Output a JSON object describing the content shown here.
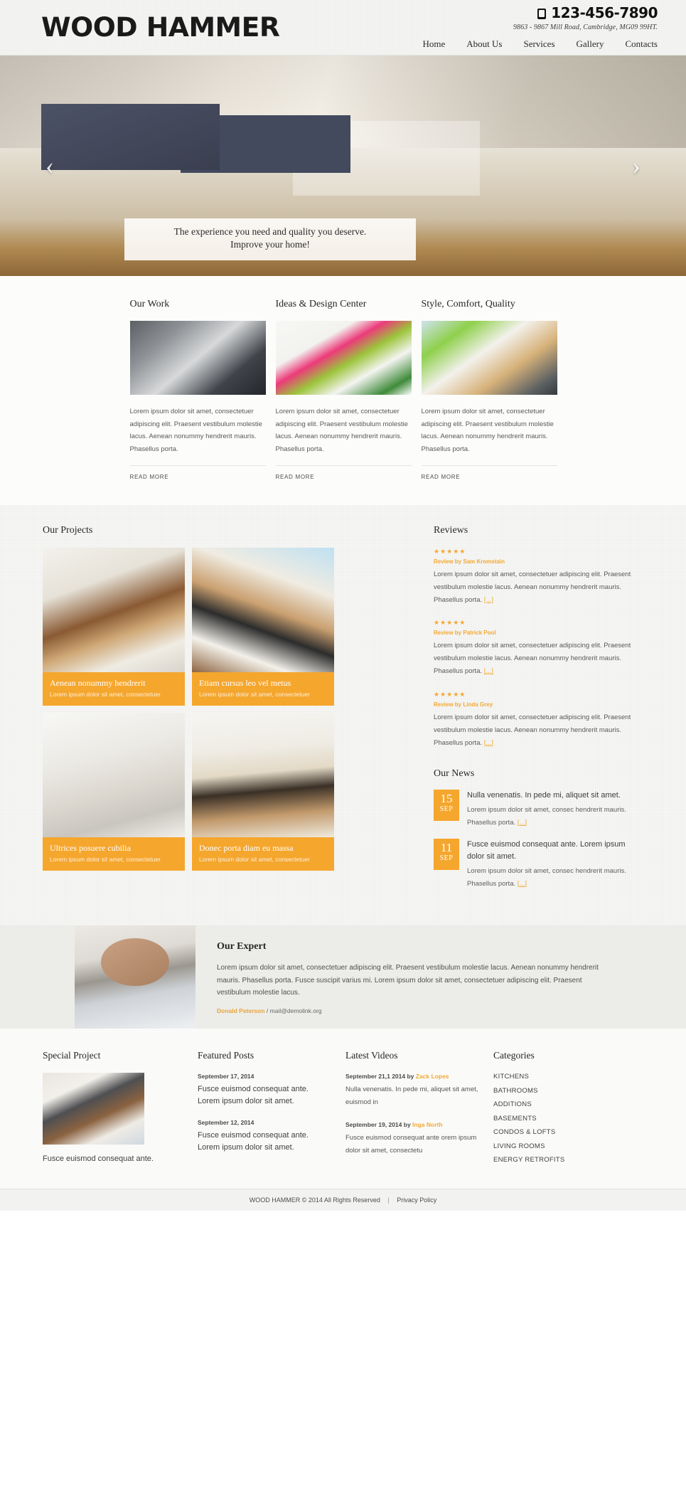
{
  "header": {
    "logo": "WOOD HAMMER",
    "phone": "123-456-7890",
    "address": "9863 - 9867 Mill Road, Cambridge, MG09 99HT.",
    "nav": [
      {
        "label": "Home"
      },
      {
        "label": "About Us"
      },
      {
        "label": "Services"
      },
      {
        "label": "Gallery"
      },
      {
        "label": "Contacts"
      }
    ]
  },
  "slider": {
    "prev": "‹",
    "next": "›",
    "caption_line1": "The experience you need and quality you deserve.",
    "caption_line2": "Improve your home!"
  },
  "features": {
    "items": [
      {
        "title": "Our Work",
        "text": "Lorem ipsum dolor sit amet, consectetuer adipiscing elit. Praesent vestibulum molestie lacus. Aenean nonummy hendrerit mauris. Phasellus porta.",
        "link": "READ MORE"
      },
      {
        "title": "Ideas & Design Center",
        "text": "Lorem ipsum dolor sit amet, consectetuer adipiscing elit. Praesent vestibulum molestie lacus. Aenean nonummy hendrerit mauris. Phasellus porta.",
        "link": "READ MORE"
      },
      {
        "title": "Style, Comfort, Quality",
        "text": "Lorem ipsum dolor sit amet, consectetuer adipiscing elit. Praesent vestibulum molestie lacus. Aenean nonummy hendrerit mauris. Phasellus porta.",
        "link": "READ MORE"
      }
    ]
  },
  "projects": {
    "title": "Our Projects",
    "items": [
      {
        "title": "Aenean nonummy hendrerit",
        "subtitle": "Lorem ipsum dolor sit amet, consectetuer"
      },
      {
        "title": "Etiam cursus leo vel metus",
        "subtitle": "Lorem ipsum dolor sit amet, consectetuer"
      },
      {
        "title": "Ultrices posuere cubilia",
        "subtitle": "Lorem ipsum dolor sit amet, consectetuer"
      },
      {
        "title": "Donec porta diam eu massa",
        "subtitle": "Lorem ipsum dolor sit amet, consectetuer"
      }
    ]
  },
  "reviews": {
    "title": "Reviews",
    "stars": "★★★★★",
    "by_label": "Review by ",
    "more": "[...]",
    "items": [
      {
        "author": "Sam Kromstain",
        "text": "Lorem ipsum dolor sit amet, consectetuer adipiscing elit. Praesent vestibulum molestie lacus. Aenean nonummy hendrerit mauris. Phasellus porta. "
      },
      {
        "author": "Patrick Pool",
        "text": "Lorem ipsum dolor sit amet, consectetuer adipiscing elit. Praesent vestibulum molestie lacus. Aenean nonummy hendrerit mauris. Phasellus porta. "
      },
      {
        "author": "Linda Grey",
        "text": "Lorem ipsum dolor sit amet, consectetuer adipiscing elit. Praesent vestibulum molestie lacus. Aenean nonummy hendrerit mauris. Phasellus porta. "
      }
    ]
  },
  "news": {
    "title": "Our News",
    "more": "[...]",
    "items": [
      {
        "day": "15",
        "month": "SEP",
        "headline": "Nulla venenatis. In pede mi, aliquet sit amet.",
        "text": "Lorem ipsum dolor sit amet, consec hendrerit mauris. Phasellus porta. "
      },
      {
        "day": "11",
        "month": "SEP",
        "headline": "Fusce euismod consequat ante. Lorem ipsum dolor sit amet.",
        "text": "Lorem ipsum dolor sit amet, consec hendrerit mauris. Phasellus porta. "
      }
    ]
  },
  "expert": {
    "title": "Our Expert",
    "text": "Lorem ipsum dolor sit amet, consectetuer adipiscing elit. Praesent vestibulum molestie lacus. Aenean nonummy hendrerit mauris. Phasellus porta. Fusce suscipit varius mi. Lorem ipsum dolor sit amet, consectetuer adipiscing elit. Praesent vestibulum molestie lacus.",
    "name": "Donald Peterson",
    "email_sep": "/",
    "email": "mail@demolink.org"
  },
  "footer": {
    "special_project": {
      "title": "Special Project",
      "caption": "Fusce euismod consequat ante."
    },
    "featured_posts": {
      "title": "Featured Posts",
      "items": [
        {
          "date": "September 17, 2014",
          "text": "Fusce euismod consequat ante. Lorem ipsum dolor sit amet."
        },
        {
          "date": "September 12, 2014",
          "text": "Fusce euismod consequat ante. Lorem ipsum dolor sit amet."
        }
      ]
    },
    "latest_videos": {
      "title": "Latest Videos",
      "by_label": " by ",
      "items": [
        {
          "date": "September 21,1 2014",
          "author": "Zack Lopes",
          "text": "Nulla venenatis. In pede mi, aliquet sit amet, euismod in"
        },
        {
          "date": "September 19, 2014",
          "author": "Inga North",
          "text": "Fusce euismod consequat ante orem ipsum dolor sit amet, consectetu"
        }
      ]
    },
    "categories": {
      "title": "Categories",
      "items": [
        {
          "label": "KITCHENS"
        },
        {
          "label": "BATHROOMS"
        },
        {
          "label": "ADDITIONS"
        },
        {
          "label": "BASEMENTS"
        },
        {
          "label": "CONDOS & LOFTS"
        },
        {
          "label": "LIVING ROOMS"
        },
        {
          "label": "ENERGY RETROFITS"
        }
      ]
    }
  },
  "copyright": {
    "text": "WOOD HAMMER © 2014 All Rights Reserved",
    "separator": "|",
    "privacy": "Privacy Policy"
  },
  "colors": {
    "accent": "#f5a62d",
    "link": "#f2a935",
    "text": "#4a4a4a"
  }
}
